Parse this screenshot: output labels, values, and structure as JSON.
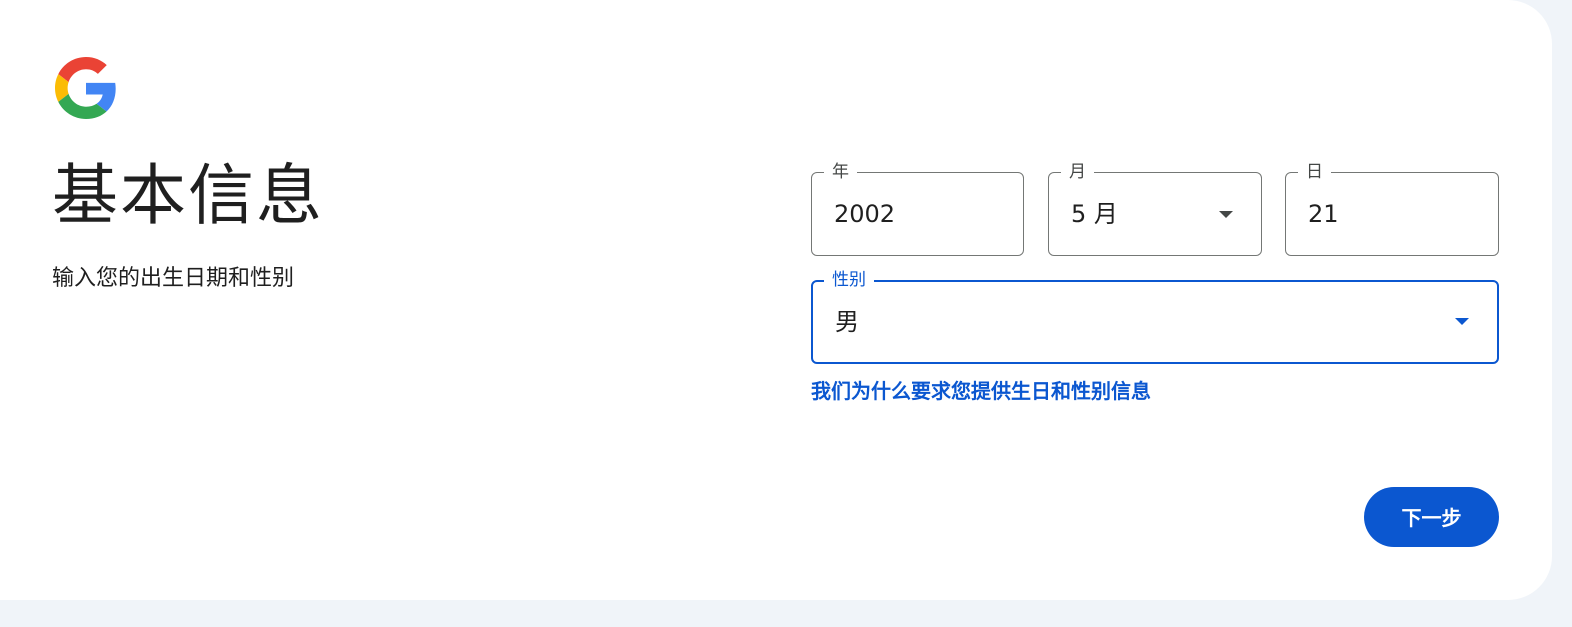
{
  "page": {
    "title": "基本信息",
    "subtitle": "输入您的出生日期和性别"
  },
  "form": {
    "year": {
      "label": "年",
      "value": "2002"
    },
    "month": {
      "label": "月",
      "value": "5 月"
    },
    "day": {
      "label": "日",
      "value": "21"
    },
    "gender": {
      "label": "性别",
      "value": "男"
    },
    "help_link": "我们为什么要求您提供生日和性别信息",
    "next_label": "下一步"
  },
  "icons": {
    "logo": "google-logo-icon",
    "dropdown": "arrow-drop-down-icon"
  },
  "colors": {
    "accent": "#0b57d0",
    "background": "#f0f4f9",
    "card": "#ffffff",
    "text": "#1f1f1f",
    "outline": "#747775"
  }
}
